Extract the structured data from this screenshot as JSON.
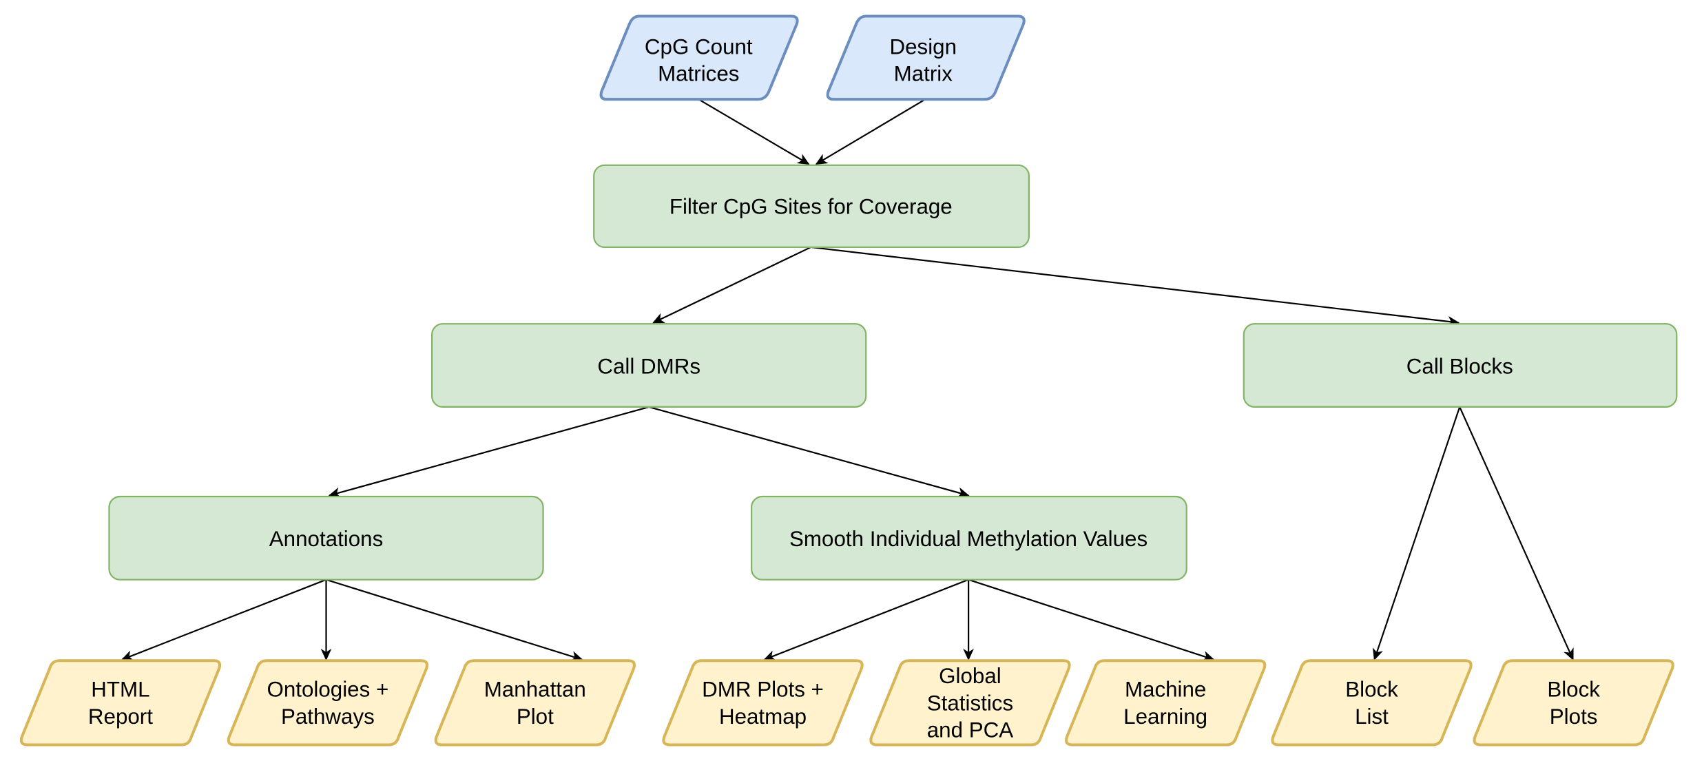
{
  "colors": {
    "input_fill": "#dae8fc",
    "input_stroke": "#6c8ebf",
    "process_fill": "#d5e8d4",
    "process_stroke": "#82b366",
    "output_fill": "#fff2cc",
    "output_stroke": "#d6b656"
  },
  "inputs": [
    {
      "lines": [
        "CpG Count",
        "Matrices"
      ]
    },
    {
      "lines": [
        "Design",
        "Matrix"
      ]
    }
  ],
  "processes": {
    "filter": "Filter CpG Sites for Coverage",
    "call_dmrs": "Call DMRs",
    "call_blocks": "Call Blocks",
    "annotations": "Annotations",
    "smooth": "Smooth Individual Methylation Values"
  },
  "outputs": [
    {
      "lines": [
        "HTML",
        "Report"
      ]
    },
    {
      "lines": [
        "Ontologies +",
        "Pathways"
      ]
    },
    {
      "lines": [
        "Manhattan",
        "Plot"
      ]
    },
    {
      "lines": [
        "DMR Plots +",
        "Heatmap"
      ]
    },
    {
      "lines": [
        "Global",
        "Statistics",
        "and PCA"
      ]
    },
    {
      "lines": [
        "Machine",
        "Learning"
      ]
    },
    {
      "lines": [
        "Block",
        "List"
      ]
    },
    {
      "lines": [
        "Block",
        "Plots"
      ]
    }
  ]
}
